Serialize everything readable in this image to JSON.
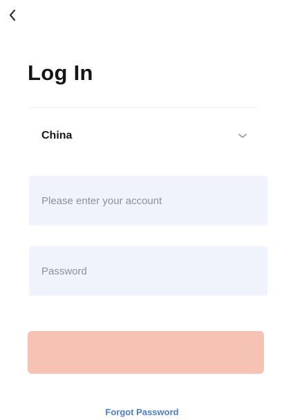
{
  "header": {
    "back_icon": "chevron-left-icon",
    "title": "Log In"
  },
  "region": {
    "selected": "China",
    "dropdown_icon": "chevron-down-icon"
  },
  "form": {
    "account_placeholder": "Please enter your account",
    "account_value": "",
    "password_placeholder": "Password",
    "password_value": "",
    "login_label": ""
  },
  "links": {
    "forgot_password": "Forgot Password"
  },
  "colors": {
    "input_background": "#f0f3fb",
    "login_button": "#f6c2b3",
    "link": "#4a7fc9"
  }
}
